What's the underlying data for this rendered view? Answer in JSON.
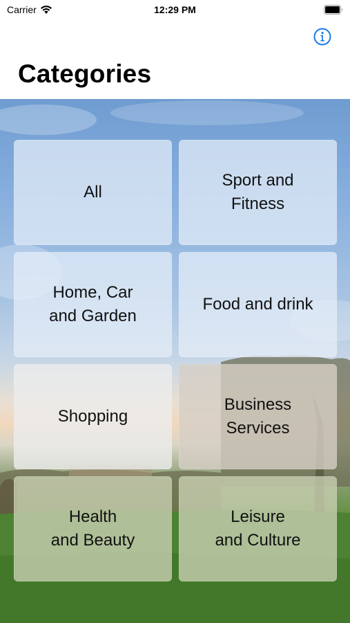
{
  "status_bar": {
    "carrier": "Carrier",
    "time": "12:29 PM"
  },
  "nav": {
    "title": "Categories",
    "info_icon": "info-circle-icon"
  },
  "colors": {
    "accent": "#1a7cf0"
  },
  "categories": [
    {
      "label": "All"
    },
    {
      "label": "Sport and\nFitness"
    },
    {
      "label": "Home, Car\nand Garden"
    },
    {
      "label": "Food and drink"
    },
    {
      "label": "Shopping"
    },
    {
      "label": "Business\nServices"
    },
    {
      "label": "Health\nand Beauty"
    },
    {
      "label": "Leisure\nand Culture"
    }
  ]
}
